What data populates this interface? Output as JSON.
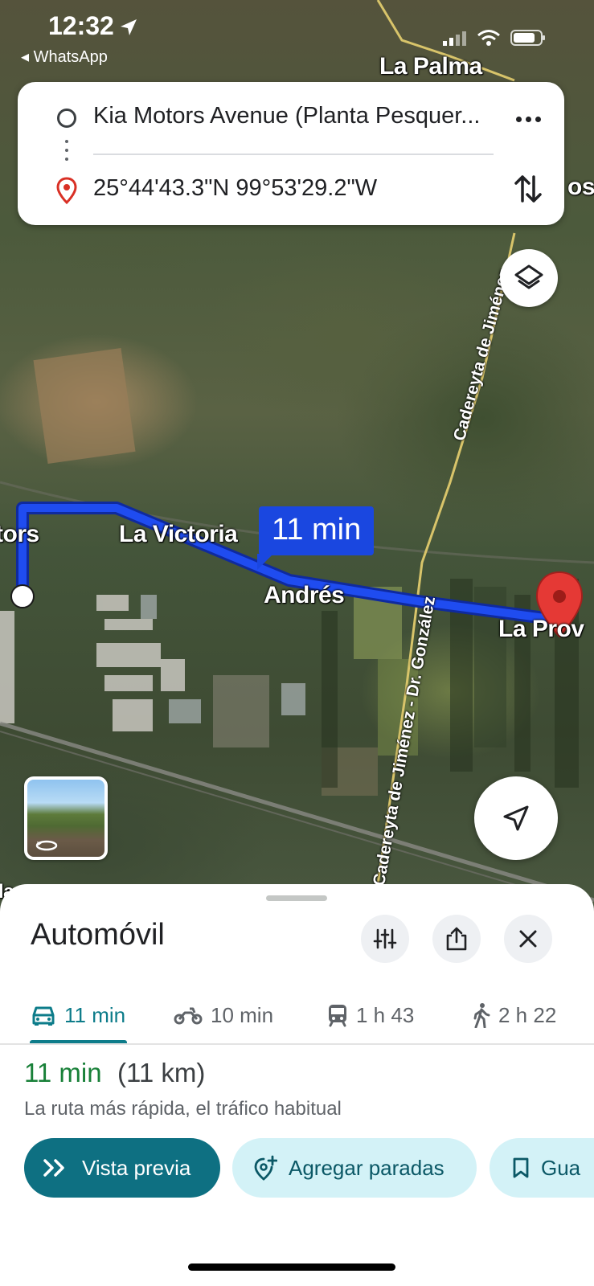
{
  "status_bar": {
    "time": "12:32",
    "back_app": "◂ WhatsApp"
  },
  "route_card": {
    "origin": "Kia Motors Avenue (Planta Pesquer...",
    "destination": "25°44'43.3\"N 99°53'29.2\"W"
  },
  "map": {
    "labels": {
      "la_palma": "La Palma",
      "tors": "tors",
      "la_victoria": "La Victoria",
      "andres": "Andrés",
      "la_prov": "La Prov",
      "la_edge": "la",
      "os_edge": "os"
    },
    "road_labels": {
      "upper": "Cadereyta de Jiménez -",
      "middle": "Cadereyta de Jiménez - Dr. González"
    },
    "route_bubble": "11 min",
    "route_color": "#1a47e0"
  },
  "sheet": {
    "title": "Automóvil",
    "modes": [
      {
        "icon": "car-icon",
        "label": "11 min"
      },
      {
        "icon": "motorcycle-icon",
        "label": "10 min"
      },
      {
        "icon": "transit-icon",
        "label": "1 h 43"
      },
      {
        "icon": "walk-icon",
        "label": "2 h 22"
      }
    ],
    "route_time": "11 min",
    "route_distance": "(11 km)",
    "route_description": "La ruta más rápida, el tráfico habitual",
    "buttons": {
      "preview": "Vista previa",
      "add_stops": "Agregar paradas",
      "save": "Gua"
    }
  },
  "colors": {
    "accent": "#0e7082",
    "active_tab": "#0d7c8a",
    "duration_green": "#188038"
  }
}
